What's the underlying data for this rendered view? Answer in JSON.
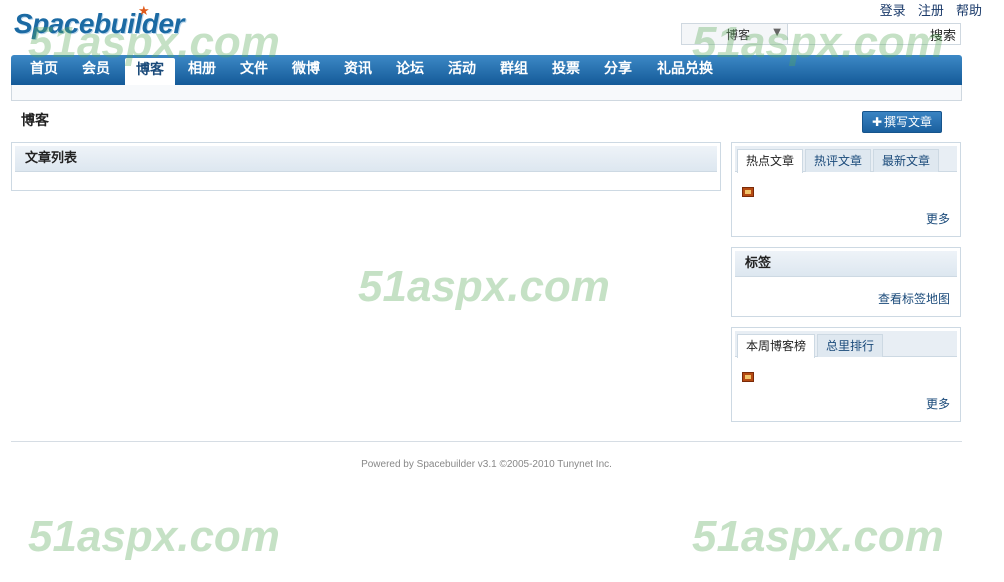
{
  "header": {
    "logo": "Spacebuilder",
    "top_links": [
      "登录",
      "注册",
      "帮助"
    ],
    "search_scope": "博客",
    "search_placeholder": "",
    "search_button": "搜索"
  },
  "nav": {
    "items": [
      "首页",
      "会员",
      "博客",
      "相册",
      "文件",
      "微博",
      "资讯",
      "论坛",
      "活动",
      "群组",
      "投票",
      "分享",
      "礼品兑换"
    ],
    "active": "博客"
  },
  "page": {
    "title": "博客",
    "write_button": "撰写文章",
    "list_title": "文章列表"
  },
  "sidebar": {
    "hot_tabs": [
      "热点文章",
      "热评文章",
      "最新文章"
    ],
    "hot_more": "更多",
    "tags_title": "标签",
    "tags_link": "查看标签地图",
    "rank_tabs": [
      "本周博客榜",
      "总里排行"
    ],
    "rank_more": "更多"
  },
  "footer": {
    "text": "Powered by Spacebuilder v3.1 ©2005-2010 Tunynet Inc."
  },
  "watermark": {
    "text": "51aspx.com"
  },
  "colors": {
    "nav_top": "#3d89c6",
    "nav_bottom": "#145a98",
    "link": "#1a4a7a",
    "watermark": "#5aaa5a"
  }
}
